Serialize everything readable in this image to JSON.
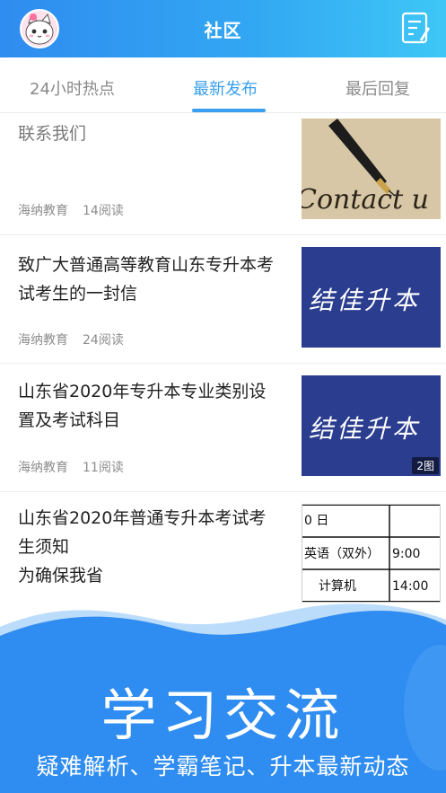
{
  "header": {
    "title": "社区",
    "avatar_icon": "cat-avatar-icon",
    "compose_icon": "compose-note-icon",
    "gradient_start": "#2f8cf0",
    "gradient_end": "#3ec7f6"
  },
  "tabs": [
    {
      "label": "24小时热点",
      "active": false
    },
    {
      "label": "最新发布",
      "active": true
    },
    {
      "label": "最后回复",
      "active": false
    }
  ],
  "accent_color": "#3a9ff0",
  "posts": [
    {
      "title": "联系我们",
      "author": "海纳教育",
      "reads": "14阅读",
      "thumb": "fountain-pen-contact-us",
      "thumb_text": "Contact u"
    },
    {
      "title": "致广大普通高等教育山东专升本考试考生的一封信",
      "author": "海纳教育",
      "reads": "24阅读",
      "thumb": "calligraphy-banner",
      "thumb_text": "结佳升本"
    },
    {
      "title": "山东省2020年专升本专业类别设置及考试科目",
      "author": "海纳教育",
      "reads": "11阅读",
      "thumb": "calligraphy-banner",
      "thumb_text": "结佳升本",
      "badge": "2图"
    },
    {
      "title": "山东省2020年普通专升本考试考生须知\n为确保我省",
      "thumb": "exam-schedule-table",
      "thumb_rows": [
        [
          "0 日",
          ""
        ],
        [
          "英语（双外）",
          "9:00"
        ],
        [
          "计算机",
          "14:00"
        ]
      ]
    }
  ],
  "footer": {
    "title": "学习交流",
    "subtitle": "疑难解析、学霸笔记、升本最新动态",
    "color": "#2f8cf0"
  }
}
